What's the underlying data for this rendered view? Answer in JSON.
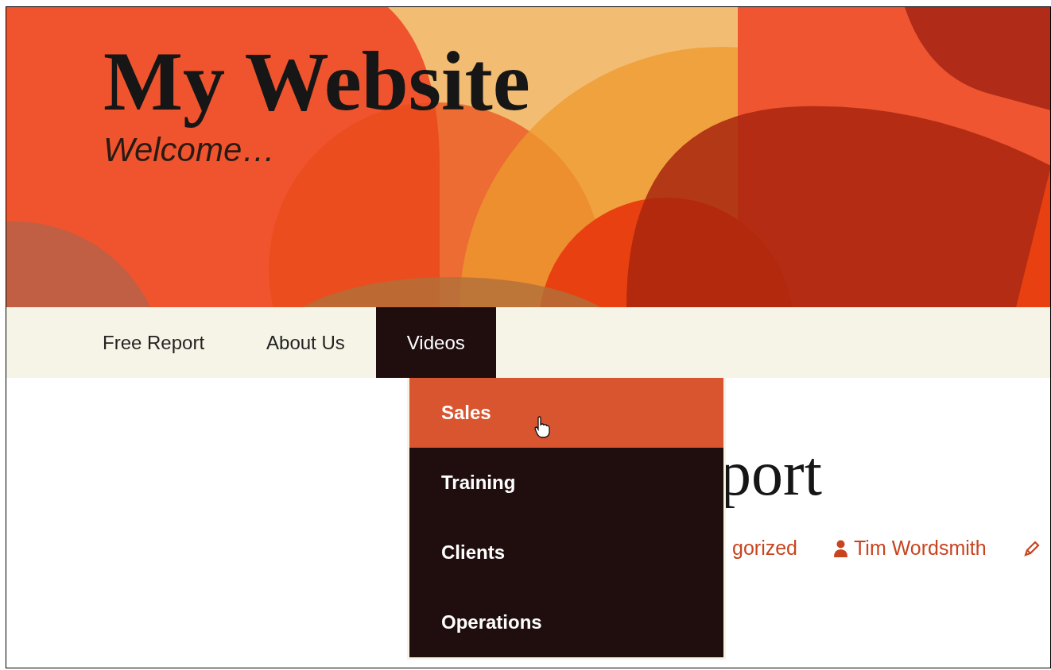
{
  "site": {
    "title": "My Website",
    "tagline": "Welcome…"
  },
  "nav": [
    {
      "label": "Free Report",
      "selected": false
    },
    {
      "label": "About Us",
      "selected": false
    },
    {
      "label": "Videos",
      "selected": true
    }
  ],
  "dropdown": [
    {
      "label": "Sales",
      "selected": true
    },
    {
      "label": "Training",
      "selected": false
    },
    {
      "label": "Clients",
      "selected": false
    },
    {
      "label": "Operations",
      "selected": false
    }
  ],
  "post": {
    "title": "port",
    "category": "gorized",
    "author": "Tim Wordsmith"
  }
}
